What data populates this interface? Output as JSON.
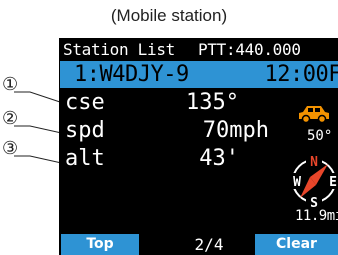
{
  "caption": "(Mobile station)",
  "header": {
    "title": "Station List",
    "ptt": "PTT:440.000"
  },
  "selected_station": {
    "callsign": "1:W4DJY-9",
    "time": "12:00F"
  },
  "rows": [
    {
      "label": "cse",
      "value": "135°"
    },
    {
      "label": "spd",
      "value": "70mph"
    },
    {
      "label": "alt",
      "value": "43'"
    }
  ],
  "temperature": "50°",
  "distance": "11.9mi",
  "compass": {
    "n": "N",
    "w": "W",
    "e": "E",
    "s": "S"
  },
  "softkeys": {
    "left": "Top",
    "page": "2/4",
    "right": "Clear"
  },
  "callouts": [
    "①",
    "②",
    "③"
  ],
  "colors": {
    "accent": "#2e93d4",
    "car": "#f39200",
    "needle": "#e8462a"
  }
}
